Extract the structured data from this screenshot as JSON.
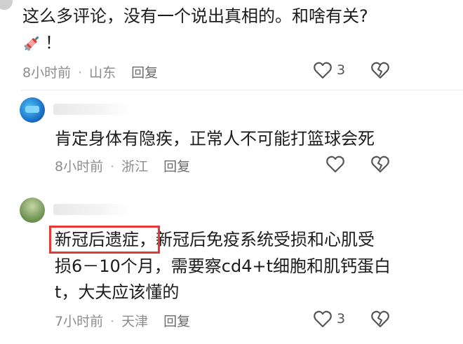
{
  "comment_1": {
    "text_line1": "这么多评论，没有一个说出真相的。和啥有关?",
    "text_line2": "！",
    "emoji_icon": "syringe-icon",
    "time": "8小时前",
    "location": "山东",
    "reply_label": "回复",
    "likes": "3"
  },
  "comment_2": {
    "text": "肯定身体有隐疾，正常人不可能打篮球会死",
    "time": "8小时前",
    "location": "浙江",
    "reply_label": "回复"
  },
  "comment_3": {
    "highlight": "新冠后遗症",
    "text_line1_rest": "，新冠后免疫系统受损和心肌受",
    "text_line2": "损6－10个月，需要察cd4+t细胞和肌钙蛋白",
    "text_line3": "t，大夫应该懂的",
    "time": "7小时前",
    "location": "天津",
    "reply_label": "回复",
    "likes": "3",
    "highlight_color": "#e53935"
  },
  "icons": {
    "like": "heart-outline-icon",
    "dislike": "broken-heart-icon"
  }
}
